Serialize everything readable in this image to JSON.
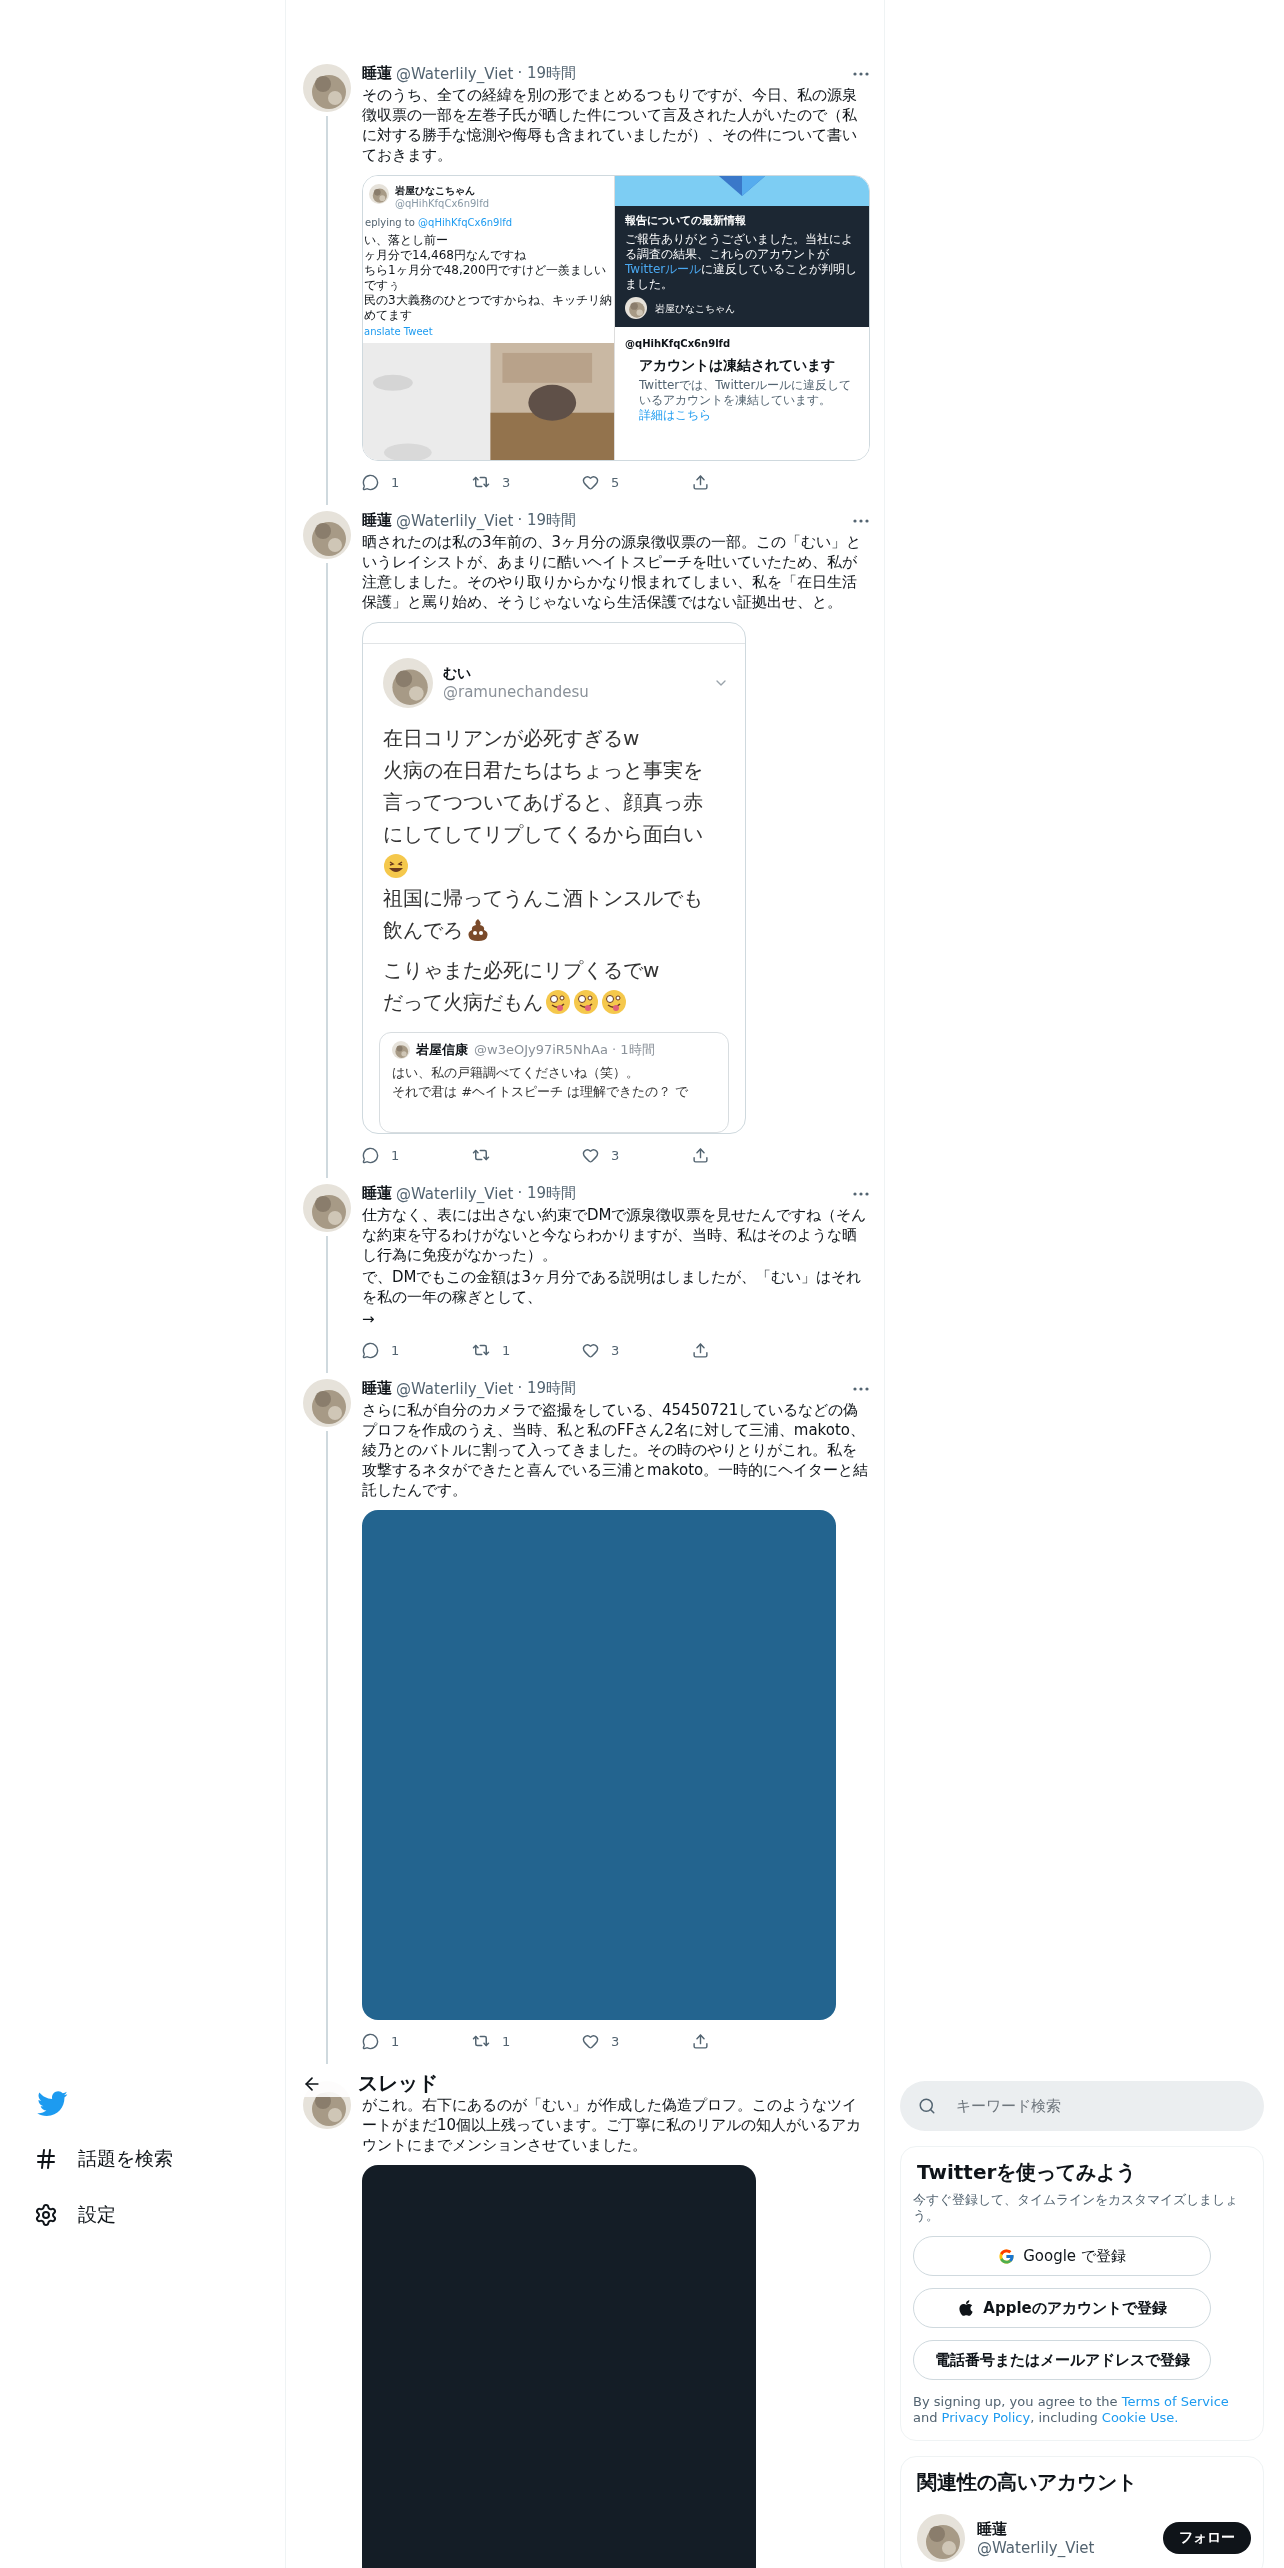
{
  "nav": {
    "items": [
      {
        "kind": "explore",
        "label": "話題を検索"
      },
      {
        "kind": "settings",
        "label": "設定"
      }
    ]
  },
  "thread": {
    "title": "スレッド",
    "tweets": [
      {
        "name": "睡蓮",
        "handle": "@Waterlily_Viet",
        "time": "· 19時間",
        "text": "そのうち、全ての経緯を別の形でまとめるつもりですが、今日、私の源泉徴収票の一部を左巻子氏が晒した件について言及された人がいたので（私に対する勝手な憶測や侮辱も含まれていましたが）、その件について書いておきます。",
        "media": {
          "kind": "collage",
          "left": {
            "name": "岩屋ひなこちゃん",
            "handle": "@qHihKfqCx6n9lfd",
            "reply_prefix": "eplying to",
            "reply_to": "@qHihKfqCx6n9lfd",
            "lines": [
              "い、落とし前ー",
              "ヶ月分で14,468円なんですね",
              "ちら1ヶ月分で48,200円ですけど一羨ましいですぅ",
              "民の3大義務のひとつですからね、キッチリ納めてます"
            ],
            "translate": "anslate Tweet"
          },
          "right": {
            "title": "報告についての最新情報",
            "body": [
              {
                "text": "ご報告ありがとうございました。当社による調査の結果、これらのアカウントが"
              },
              {
                "text": "Twitterルール",
                "link": true
              },
              {
                "text": "に違反していることが判明しました。"
              }
            ],
            "name": "岩屋ひなこちゃん",
            "handle": "@qHihKfqCx6n9lfd",
            "suspended_title": "アカウントは凍結されています",
            "suspended_body": [
              {
                "text": "Twitterでは、Twitterルールに違反しているアカウントを凍結しています。"
              },
              {
                "text": "詳細はこちら",
                "link": true
              }
            ]
          }
        },
        "reply": "1",
        "retweet": "3",
        "like": "5"
      },
      {
        "name": "睡蓮",
        "handle": "@Waterlily_Viet",
        "time": "· 19時間",
        "text": "晒されたのは私の3年前の、3ヶ月分の源泉徴収票の一部。この「むい」というレイシストが、あまりに酷いヘイトスピーチを吐いていたため、私が注意しました。そのやり取りからかなり恨まれてしまい、私を「在日生活保護」と罵り始め、そうじゃないなら生活保護ではない証拠出せ、と。",
        "media": {
          "kind": "tweet_screenshot",
          "name": "むい",
          "handle": "@ramunechandesu",
          "lines": [
            {
              "text": "在日コリアンが必死すぎるw"
            },
            {
              "text": "火病の在日君たちはちょっと事実を"
            },
            {
              "text": "言ってつついてあげると、顔真っ赤"
            },
            {
              "text": "にしてしてリプしてくるから面白い"
            },
            {
              "emoji": [
                {
                  "kind": "grin"
                }
              ]
            },
            {
              "text": "祖国に帰ってうんこ酒トンスルでも"
            },
            {
              "text": "飲んでろ",
              "emoji": [
                {
                  "kind": "poop"
                }
              ]
            },
            {
              "text": "こりゃまた必死にリプくるでw",
              "gap": true
            },
            {
              "text": "だって火病だもん",
              "emoji": [
                {
                  "kind": "zany"
                },
                {
                  "kind": "zany"
                },
                {
                  "kind": "zany"
                }
              ]
            }
          ],
          "quote": {
            "name": "岩屋信康",
            "handle": "@w3eOJy97iR5NhAa · 1時間",
            "lines": [
              "はい、私の戸籍調べてくださいね（笑）。",
              "それで君は #ヘイトスピーチ は理解できたの？ で"
            ]
          }
        },
        "reply": "1",
        "like": "3"
      },
      {
        "name": "睡蓮",
        "handle": "@Waterlily_Viet",
        "time": "· 19時間",
        "text": "仕方なく、表には出さない約束でDMで源泉徴収票を見せたんですね（そんな約束を守るわけがないと今ならわかりますが、当時、私はそのような晒し行為に免疫がなかった）。",
        "more_text": [
          "で、DMでもこの金額は3ヶ月分である説明はしましたが、「むい」はそれを私の一年の稼ぎとして、",
          "→"
        ],
        "reply": "1",
        "retweet": "1",
        "like": "3"
      },
      {
        "name": "睡蓮",
        "handle": "@Waterlily_Viet",
        "time": "· 19時間",
        "text": "さらに私が自分のカメラで盗撮をしている、45450721しているなどの偽プロフを作成のうえ、当時、私と私のFFさん2名に対して三浦、makoto、綾乃とのバトルに割って入ってきました。その時のやりとりがこれ。私を攻撃するネタができたと喜んでいる三浦とmakoto。一時的にヘイターと結託したんです。",
        "media": {
          "kind": "blank",
          "color": "#23648f"
        },
        "reply": "1",
        "retweet": "1",
        "like": "3"
      },
      {
        "text": "がこれ。右下にあるのが「むい」が作成した偽造プロフ。このようなツイートがまだ10個以上残っています。ご丁寧に私のリアルの知人がいるアカウントにまでメンションさせていました。",
        "media": {
          "kind": "blank",
          "color": "#141d26"
        }
      }
    ]
  },
  "sidebar": {
    "search": {
      "placeholder": "キーワード検索"
    },
    "signup": {
      "title": "Twitterを使ってみよう",
      "subtitle": "今すぐ登録して、タイムラインをカスタマイズしましょう。",
      "buttons": [
        {
          "kind": "google",
          "label": "Google で登録"
        },
        {
          "kind": "apple",
          "label": "Appleのアカウントで登録"
        },
        {
          "kind": "phone",
          "label": "電話番号またはメールアドレスで登録"
        }
      ],
      "legal": [
        {
          "text": "By signing up, you agree to the "
        },
        {
          "text": "Terms of Service",
          "link": true
        },
        {
          "text": " and "
        },
        {
          "text": "Privacy Policy",
          "link": true
        },
        {
          "text": ", including "
        },
        {
          "text": "Cookie Use.",
          "link": true
        }
      ]
    },
    "related": {
      "title": "関連性の高いアカウント",
      "accounts": [
        {
          "name": "睡蓮",
          "handle": "@Waterlily_Viet",
          "button": "フォロー"
        }
      ]
    }
  }
}
